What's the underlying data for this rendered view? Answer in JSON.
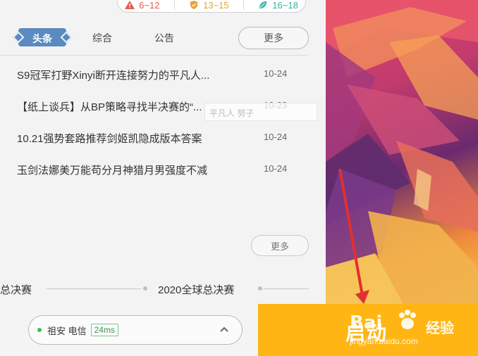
{
  "ranges": [
    {
      "label": "6~12",
      "color": "#e25a4e",
      "icon": "warning-icon"
    },
    {
      "label": "13~15",
      "color": "#e8a13a",
      "icon": "shield-check-icon"
    },
    {
      "label": "16~18",
      "color": "#38b2a2",
      "icon": "leaf-icon"
    }
  ],
  "tabs": [
    {
      "label": "头条",
      "active": true
    },
    {
      "label": "综合",
      "active": false
    },
    {
      "label": "公告",
      "active": false
    }
  ],
  "more_label": "更多",
  "news": [
    {
      "title": "S9冠军打野Xinyi断开连接努力的平凡人...",
      "date": "10-24"
    },
    {
      "title": "【纸上谈兵】从BP策略寻找半决赛的“...",
      "date": "10-23"
    },
    {
      "title": "10.21强势套路推荐剑姬凯隐成版本答案",
      "date": "10-24"
    },
    {
      "title": "玉剑法娜美万能苟分月神猎月男强度不减",
      "date": "10-24"
    }
  ],
  "tooltip_ghost": "平凡人  努子",
  "more_bottom_label": "更多",
  "timeline": {
    "left_label": "总决赛",
    "right_label": "2020全球总决赛"
  },
  "server": {
    "name": "祖安 电信",
    "ping": "24ms",
    "status": "online"
  },
  "launch_label": "启动",
  "watermark": {
    "logo": "Bai",
    "brand": "经验",
    "url": "jingyan.baidu.com"
  },
  "colors": {
    "accent": "#5a8ac0",
    "launch": "#ffb513",
    "online": "#3bbf4f"
  }
}
